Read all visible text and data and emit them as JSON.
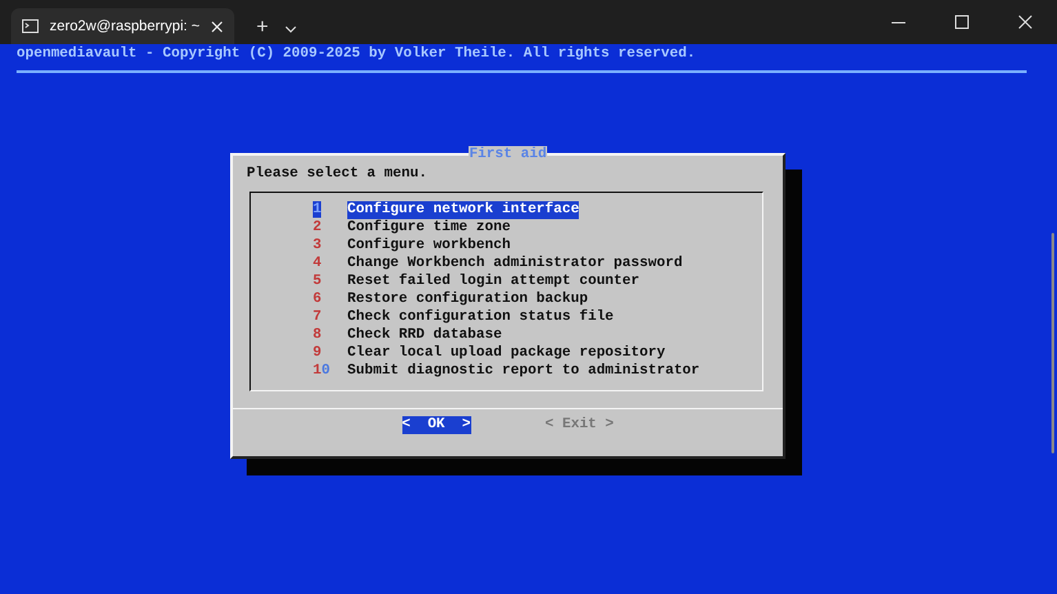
{
  "window": {
    "tab_title": "zero2w@raspberrypi: ~",
    "new_tab": "+"
  },
  "terminal": {
    "header": "openmediavault - Copyright (C) 2009-2025 by Volker Theile. All rights reserved."
  },
  "dialog": {
    "title": "First aid",
    "prompt": "Please select a menu.",
    "items": [
      {
        "tag": "1",
        "label": "Configure network interface",
        "selected": true
      },
      {
        "tag": "2",
        "label": "Configure time zone",
        "selected": false
      },
      {
        "tag": "3",
        "label": "Configure workbench",
        "selected": false
      },
      {
        "tag": "4",
        "label": "Change Workbench administrator password",
        "selected": false
      },
      {
        "tag": "5",
        "label": "Reset failed login attempt counter",
        "selected": false
      },
      {
        "tag": "6",
        "label": "Restore configuration backup",
        "selected": false
      },
      {
        "tag": "7",
        "label": "Check configuration status file",
        "selected": false
      },
      {
        "tag": "8",
        "label": "Check RRD database",
        "selected": false
      },
      {
        "tag": "9",
        "label": "Clear local upload package repository",
        "selected": false
      },
      {
        "tag": "10",
        "label": "Submit diagnostic report to administrator",
        "selected": false
      }
    ],
    "buttons": [
      {
        "label": "<  OK  >",
        "selected": true
      },
      {
        "label": "< Exit >",
        "selected": false
      }
    ]
  }
}
